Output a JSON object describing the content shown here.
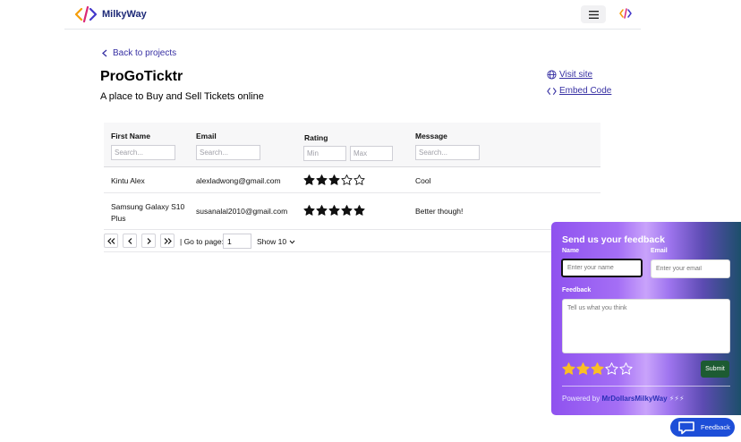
{
  "header": {
    "logo_text": "MilkyWay",
    "logo_icon": "code-brackets-icon",
    "menu_icon": "hamburger-icon"
  },
  "back_link": "Back to projects",
  "project": {
    "title": "ProGoTicktr",
    "subtitle": "A place to Buy and Sell Tickets online",
    "visit_site": "Visit site",
    "embed_code": "Embed Code"
  },
  "table": {
    "columns": {
      "first_name": "First Name",
      "email": "Email",
      "rating": "Rating",
      "message": "Message"
    },
    "placeholders": {
      "search": "Search...",
      "min": "Min",
      "max": "Max"
    },
    "rows": [
      {
        "first_name": "Kintu Alex",
        "email": "alexladwong@gmail.com",
        "rating": 3,
        "message": "Cool"
      },
      {
        "first_name": "Samsung Galaxy S10 Plus",
        "email": "susanalal2010@gmail.com",
        "rating": 5,
        "message": "Better though!"
      }
    ]
  },
  "pagination": {
    "goto_label": "| Go to page:",
    "page_value": "1",
    "show_label": "Show 10"
  },
  "feedback": {
    "title": "Send us your feedback",
    "name_label": "Name",
    "email_label": "Email",
    "name_placeholder": "Enter your name",
    "email_placeholder": "Enter your email",
    "feedback_label": "Feedback",
    "feedback_placeholder": "Tell us what you think",
    "rating": 3,
    "submit_label": "Submit",
    "powered_prefix": "Powered by",
    "powered_brand": "MrDollarsMilkyWay",
    "powered_suffix": "⚡⚡⚡",
    "toggle_label": "Feedback"
  },
  "colors": {
    "link": "#3730a3",
    "star_filled_table": "#111111",
    "star_filled_feedback": "#fbbf24",
    "submit_bg": "#1d5b32",
    "toggle_bg": "#1d4ed8"
  }
}
